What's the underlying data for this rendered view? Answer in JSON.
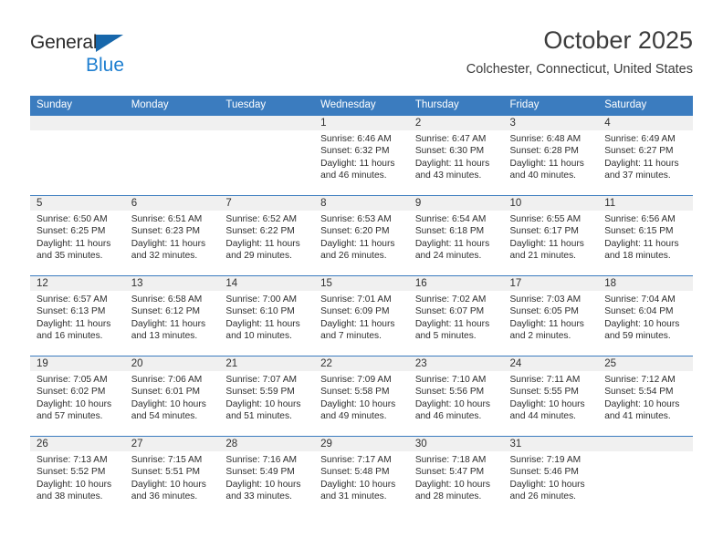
{
  "brand": {
    "line1": "General",
    "line2": "Blue",
    "triangle_color": "#1767ab",
    "blue_color": "#1f7fd0"
  },
  "header": {
    "title": "October 2025",
    "subtitle": "Colchester, Connecticut, United States"
  },
  "colors": {
    "header_blue": "#3b7cbf",
    "daynum_band": "#f0f0f0",
    "text": "#2e2e2e"
  },
  "weekday_headers": [
    "Sunday",
    "Monday",
    "Tuesday",
    "Wednesday",
    "Thursday",
    "Friday",
    "Saturday"
  ],
  "labels": {
    "sunrise_prefix": "Sunrise:",
    "sunset_prefix": "Sunset:",
    "daylight_prefix": "Daylight:"
  },
  "weeks": [
    [
      {
        "day": "",
        "l1": "",
        "l2": "",
        "l3": "",
        "l4": ""
      },
      {
        "day": "",
        "l1": "",
        "l2": "",
        "l3": "",
        "l4": ""
      },
      {
        "day": "",
        "l1": "",
        "l2": "",
        "l3": "",
        "l4": ""
      },
      {
        "day": "1",
        "l1": "Sunrise: 6:46 AM",
        "l2": "Sunset: 6:32 PM",
        "l3": "Daylight: 11 hours",
        "l4": "and 46 minutes."
      },
      {
        "day": "2",
        "l1": "Sunrise: 6:47 AM",
        "l2": "Sunset: 6:30 PM",
        "l3": "Daylight: 11 hours",
        "l4": "and 43 minutes."
      },
      {
        "day": "3",
        "l1": "Sunrise: 6:48 AM",
        "l2": "Sunset: 6:28 PM",
        "l3": "Daylight: 11 hours",
        "l4": "and 40 minutes."
      },
      {
        "day": "4",
        "l1": "Sunrise: 6:49 AM",
        "l2": "Sunset: 6:27 PM",
        "l3": "Daylight: 11 hours",
        "l4": "and 37 minutes."
      }
    ],
    [
      {
        "day": "5",
        "l1": "Sunrise: 6:50 AM",
        "l2": "Sunset: 6:25 PM",
        "l3": "Daylight: 11 hours",
        "l4": "and 35 minutes."
      },
      {
        "day": "6",
        "l1": "Sunrise: 6:51 AM",
        "l2": "Sunset: 6:23 PM",
        "l3": "Daylight: 11 hours",
        "l4": "and 32 minutes."
      },
      {
        "day": "7",
        "l1": "Sunrise: 6:52 AM",
        "l2": "Sunset: 6:22 PM",
        "l3": "Daylight: 11 hours",
        "l4": "and 29 minutes."
      },
      {
        "day": "8",
        "l1": "Sunrise: 6:53 AM",
        "l2": "Sunset: 6:20 PM",
        "l3": "Daylight: 11 hours",
        "l4": "and 26 minutes."
      },
      {
        "day": "9",
        "l1": "Sunrise: 6:54 AM",
        "l2": "Sunset: 6:18 PM",
        "l3": "Daylight: 11 hours",
        "l4": "and 24 minutes."
      },
      {
        "day": "10",
        "l1": "Sunrise: 6:55 AM",
        "l2": "Sunset: 6:17 PM",
        "l3": "Daylight: 11 hours",
        "l4": "and 21 minutes."
      },
      {
        "day": "11",
        "l1": "Sunrise: 6:56 AM",
        "l2": "Sunset: 6:15 PM",
        "l3": "Daylight: 11 hours",
        "l4": "and 18 minutes."
      }
    ],
    [
      {
        "day": "12",
        "l1": "Sunrise: 6:57 AM",
        "l2": "Sunset: 6:13 PM",
        "l3": "Daylight: 11 hours",
        "l4": "and 16 minutes."
      },
      {
        "day": "13",
        "l1": "Sunrise: 6:58 AM",
        "l2": "Sunset: 6:12 PM",
        "l3": "Daylight: 11 hours",
        "l4": "and 13 minutes."
      },
      {
        "day": "14",
        "l1": "Sunrise: 7:00 AM",
        "l2": "Sunset: 6:10 PM",
        "l3": "Daylight: 11 hours",
        "l4": "and 10 minutes."
      },
      {
        "day": "15",
        "l1": "Sunrise: 7:01 AM",
        "l2": "Sunset: 6:09 PM",
        "l3": "Daylight: 11 hours",
        "l4": "and 7 minutes."
      },
      {
        "day": "16",
        "l1": "Sunrise: 7:02 AM",
        "l2": "Sunset: 6:07 PM",
        "l3": "Daylight: 11 hours",
        "l4": "and 5 minutes."
      },
      {
        "day": "17",
        "l1": "Sunrise: 7:03 AM",
        "l2": "Sunset: 6:05 PM",
        "l3": "Daylight: 11 hours",
        "l4": "and 2 minutes."
      },
      {
        "day": "18",
        "l1": "Sunrise: 7:04 AM",
        "l2": "Sunset: 6:04 PM",
        "l3": "Daylight: 10 hours",
        "l4": "and 59 minutes."
      }
    ],
    [
      {
        "day": "19",
        "l1": "Sunrise: 7:05 AM",
        "l2": "Sunset: 6:02 PM",
        "l3": "Daylight: 10 hours",
        "l4": "and 57 minutes."
      },
      {
        "day": "20",
        "l1": "Sunrise: 7:06 AM",
        "l2": "Sunset: 6:01 PM",
        "l3": "Daylight: 10 hours",
        "l4": "and 54 minutes."
      },
      {
        "day": "21",
        "l1": "Sunrise: 7:07 AM",
        "l2": "Sunset: 5:59 PM",
        "l3": "Daylight: 10 hours",
        "l4": "and 51 minutes."
      },
      {
        "day": "22",
        "l1": "Sunrise: 7:09 AM",
        "l2": "Sunset: 5:58 PM",
        "l3": "Daylight: 10 hours",
        "l4": "and 49 minutes."
      },
      {
        "day": "23",
        "l1": "Sunrise: 7:10 AM",
        "l2": "Sunset: 5:56 PM",
        "l3": "Daylight: 10 hours",
        "l4": "and 46 minutes."
      },
      {
        "day": "24",
        "l1": "Sunrise: 7:11 AM",
        "l2": "Sunset: 5:55 PM",
        "l3": "Daylight: 10 hours",
        "l4": "and 44 minutes."
      },
      {
        "day": "25",
        "l1": "Sunrise: 7:12 AM",
        "l2": "Sunset: 5:54 PM",
        "l3": "Daylight: 10 hours",
        "l4": "and 41 minutes."
      }
    ],
    [
      {
        "day": "26",
        "l1": "Sunrise: 7:13 AM",
        "l2": "Sunset: 5:52 PM",
        "l3": "Daylight: 10 hours",
        "l4": "and 38 minutes."
      },
      {
        "day": "27",
        "l1": "Sunrise: 7:15 AM",
        "l2": "Sunset: 5:51 PM",
        "l3": "Daylight: 10 hours",
        "l4": "and 36 minutes."
      },
      {
        "day": "28",
        "l1": "Sunrise: 7:16 AM",
        "l2": "Sunset: 5:49 PM",
        "l3": "Daylight: 10 hours",
        "l4": "and 33 minutes."
      },
      {
        "day": "29",
        "l1": "Sunrise: 7:17 AM",
        "l2": "Sunset: 5:48 PM",
        "l3": "Daylight: 10 hours",
        "l4": "and 31 minutes."
      },
      {
        "day": "30",
        "l1": "Sunrise: 7:18 AM",
        "l2": "Sunset: 5:47 PM",
        "l3": "Daylight: 10 hours",
        "l4": "and 28 minutes."
      },
      {
        "day": "31",
        "l1": "Sunrise: 7:19 AM",
        "l2": "Sunset: 5:46 PM",
        "l3": "Daylight: 10 hours",
        "l4": "and 26 minutes."
      },
      {
        "day": "",
        "l1": "",
        "l2": "",
        "l3": "",
        "l4": ""
      }
    ]
  ]
}
